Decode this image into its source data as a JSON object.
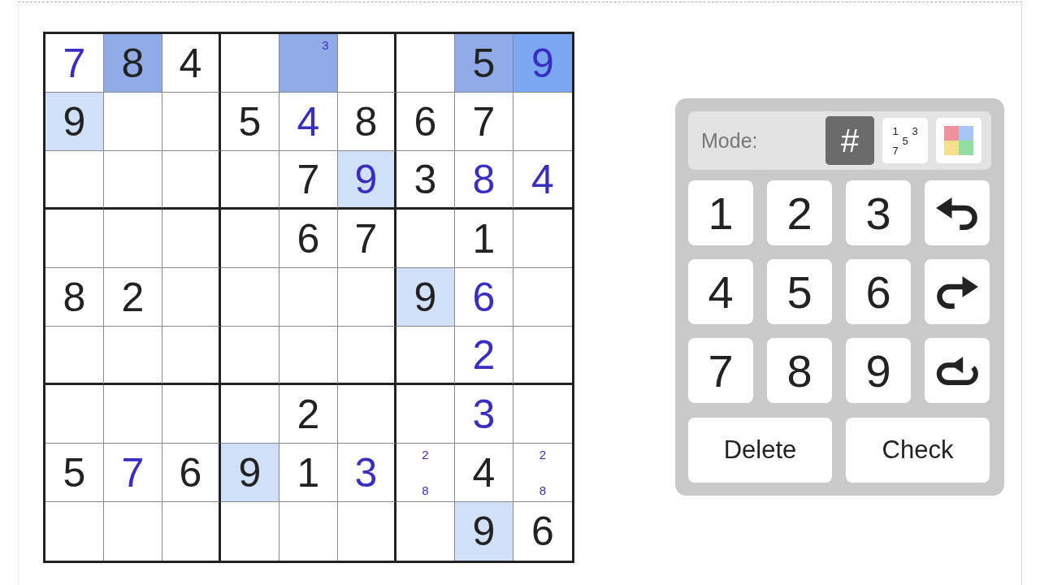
{
  "board": {
    "rows": [
      {
        "cells": [
          {
            "kind": "entered",
            "value": "7",
            "selected": false,
            "highlighted": false
          },
          {
            "kind": "given",
            "value": "8",
            "selected": true,
            "highlighted": false
          },
          {
            "kind": "given",
            "value": "4",
            "selected": false,
            "highlighted": false
          },
          {
            "kind": "empty",
            "selected": false,
            "highlighted": false
          },
          {
            "kind": "pencil",
            "marks": [
              {
                "text": "3",
                "kind": "topright"
              }
            ],
            "selected": true,
            "highlighted": false
          },
          {
            "kind": "empty",
            "selected": false,
            "highlighted": false
          },
          {
            "kind": "empty",
            "selected": false,
            "highlighted": false
          },
          {
            "kind": "given",
            "value": "5",
            "selected": true,
            "highlighted": false
          },
          {
            "kind": "entered",
            "value": "9",
            "selected": true,
            "highlighted": true
          }
        ]
      },
      {
        "cells": [
          {
            "kind": "given",
            "value": "9",
            "selected": false,
            "highlighted": true
          },
          {
            "kind": "empty",
            "selected": false,
            "highlighted": false
          },
          {
            "kind": "empty",
            "selected": false,
            "highlighted": false
          },
          {
            "kind": "given",
            "value": "5",
            "selected": false,
            "highlighted": false
          },
          {
            "kind": "entered",
            "value": "4",
            "selected": false,
            "highlighted": false
          },
          {
            "kind": "given",
            "value": "8",
            "selected": false,
            "highlighted": false
          },
          {
            "kind": "given",
            "value": "6",
            "selected": false,
            "highlighted": false
          },
          {
            "kind": "given",
            "value": "7",
            "selected": false,
            "highlighted": false
          },
          {
            "kind": "empty",
            "selected": false,
            "highlighted": false
          }
        ]
      },
      {
        "cells": [
          {
            "kind": "empty",
            "selected": false,
            "highlighted": false
          },
          {
            "kind": "empty",
            "selected": false,
            "highlighted": false
          },
          {
            "kind": "empty",
            "selected": false,
            "highlighted": false
          },
          {
            "kind": "empty",
            "selected": false,
            "highlighted": false
          },
          {
            "kind": "given",
            "value": "7",
            "selected": false,
            "highlighted": false
          },
          {
            "kind": "entered",
            "value": "9",
            "selected": false,
            "highlighted": true
          },
          {
            "kind": "given",
            "value": "3",
            "selected": false,
            "highlighted": false
          },
          {
            "kind": "entered",
            "value": "8",
            "selected": false,
            "highlighted": false
          },
          {
            "kind": "entered",
            "value": "4",
            "selected": false,
            "highlighted": false
          }
        ]
      },
      {
        "cells": [
          {
            "kind": "empty",
            "selected": false,
            "highlighted": false
          },
          {
            "kind": "empty",
            "selected": false,
            "highlighted": false
          },
          {
            "kind": "empty",
            "selected": false,
            "highlighted": false
          },
          {
            "kind": "empty",
            "selected": false,
            "highlighted": false
          },
          {
            "kind": "given",
            "value": "6",
            "selected": false,
            "highlighted": false
          },
          {
            "kind": "given",
            "value": "7",
            "selected": false,
            "highlighted": false
          },
          {
            "kind": "empty",
            "selected": false,
            "highlighted": false
          },
          {
            "kind": "given",
            "value": "1",
            "selected": false,
            "highlighted": false
          },
          {
            "kind": "empty",
            "selected": false,
            "highlighted": false
          }
        ]
      },
      {
        "cells": [
          {
            "kind": "given",
            "value": "8",
            "selected": false,
            "highlighted": false
          },
          {
            "kind": "given",
            "value": "2",
            "selected": false,
            "highlighted": false
          },
          {
            "kind": "empty",
            "selected": false,
            "highlighted": false
          },
          {
            "kind": "empty",
            "selected": false,
            "highlighted": false
          },
          {
            "kind": "empty",
            "selected": false,
            "highlighted": false
          },
          {
            "kind": "empty",
            "selected": false,
            "highlighted": false
          },
          {
            "kind": "given",
            "value": "9",
            "selected": false,
            "highlighted": true
          },
          {
            "kind": "entered",
            "value": "6",
            "selected": false,
            "highlighted": false
          },
          {
            "kind": "empty",
            "selected": false,
            "highlighted": false
          }
        ]
      },
      {
        "cells": [
          {
            "kind": "empty",
            "selected": false,
            "highlighted": false
          },
          {
            "kind": "empty",
            "selected": false,
            "highlighted": false
          },
          {
            "kind": "empty",
            "selected": false,
            "highlighted": false
          },
          {
            "kind": "empty",
            "selected": false,
            "highlighted": false
          },
          {
            "kind": "empty",
            "selected": false,
            "highlighted": false
          },
          {
            "kind": "empty",
            "selected": false,
            "highlighted": false
          },
          {
            "kind": "empty",
            "selected": false,
            "highlighted": false
          },
          {
            "kind": "entered",
            "value": "2",
            "selected": false,
            "highlighted": false
          },
          {
            "kind": "empty",
            "selected": false,
            "highlighted": false
          }
        ]
      },
      {
        "cells": [
          {
            "kind": "empty",
            "selected": false,
            "highlighted": false
          },
          {
            "kind": "empty",
            "selected": false,
            "highlighted": false
          },
          {
            "kind": "empty",
            "selected": false,
            "highlighted": false
          },
          {
            "kind": "empty",
            "selected": false,
            "highlighted": false
          },
          {
            "kind": "given",
            "value": "2",
            "selected": false,
            "highlighted": false
          },
          {
            "kind": "empty",
            "selected": false,
            "highlighted": false
          },
          {
            "kind": "empty",
            "selected": false,
            "highlighted": false
          },
          {
            "kind": "entered",
            "value": "3",
            "selected": false,
            "highlighted": false
          },
          {
            "kind": "empty",
            "selected": false,
            "highlighted": false
          }
        ]
      },
      {
        "cells": [
          {
            "kind": "given",
            "value": "5",
            "selected": false,
            "highlighted": false
          },
          {
            "kind": "entered",
            "value": "7",
            "selected": false,
            "highlighted": false
          },
          {
            "kind": "given",
            "value": "6",
            "selected": false,
            "highlighted": false
          },
          {
            "kind": "given",
            "value": "9",
            "selected": false,
            "highlighted": true
          },
          {
            "kind": "given",
            "value": "1",
            "selected": false,
            "highlighted": false
          },
          {
            "kind": "entered",
            "value": "3",
            "selected": false,
            "highlighted": false
          },
          {
            "kind": "pencil",
            "marks": [
              {
                "text": "2",
                "kind": "top"
              },
              {
                "text": "8",
                "kind": "bottom"
              }
            ],
            "selected": false,
            "highlighted": false
          },
          {
            "kind": "given",
            "value": "4",
            "selected": false,
            "highlighted": false
          },
          {
            "kind": "pencil",
            "marks": [
              {
                "text": "2",
                "kind": "top"
              },
              {
                "text": "8",
                "kind": "bottom"
              }
            ],
            "selected": false,
            "highlighted": false
          }
        ]
      },
      {
        "cells": [
          {
            "kind": "empty",
            "selected": false,
            "highlighted": false
          },
          {
            "kind": "empty",
            "selected": false,
            "highlighted": false
          },
          {
            "kind": "empty",
            "selected": false,
            "highlighted": false
          },
          {
            "kind": "empty",
            "selected": false,
            "highlighted": false
          },
          {
            "kind": "empty",
            "selected": false,
            "highlighted": false
          },
          {
            "kind": "empty",
            "selected": false,
            "highlighted": false
          },
          {
            "kind": "empty",
            "selected": false,
            "highlighted": false
          },
          {
            "kind": "given",
            "value": "9",
            "selected": false,
            "highlighted": true
          },
          {
            "kind": "given",
            "value": "6",
            "selected": false,
            "highlighted": false
          }
        ]
      }
    ]
  },
  "controls": {
    "mode": {
      "label": "Mode:",
      "options": [
        {
          "kind": "normal",
          "label": "#",
          "selected": true
        },
        {
          "kind": "pencil",
          "marks": [
            {
              "text": "1",
              "kind": "topleft"
            },
            {
              "text": "3",
              "kind": "topright"
            },
            {
              "text": "5",
              "kind": "center"
            },
            {
              "text": "7",
              "kind": "bottomleft"
            }
          ],
          "selected": false
        },
        {
          "kind": "color",
          "selected": false
        }
      ]
    },
    "keys": [
      {
        "kind": "digit",
        "label": "1"
      },
      {
        "kind": "digit",
        "label": "2"
      },
      {
        "kind": "digit",
        "label": "3"
      },
      {
        "kind": "undo"
      },
      {
        "kind": "digit",
        "label": "4"
      },
      {
        "kind": "digit",
        "label": "5"
      },
      {
        "kind": "digit",
        "label": "6"
      },
      {
        "kind": "redo"
      },
      {
        "kind": "digit",
        "label": "7"
      },
      {
        "kind": "digit",
        "label": "8"
      },
      {
        "kind": "digit",
        "label": "9"
      },
      {
        "kind": "restart"
      }
    ],
    "actions": [
      {
        "label": "Delete"
      },
      {
        "label": "Check"
      }
    ]
  }
}
